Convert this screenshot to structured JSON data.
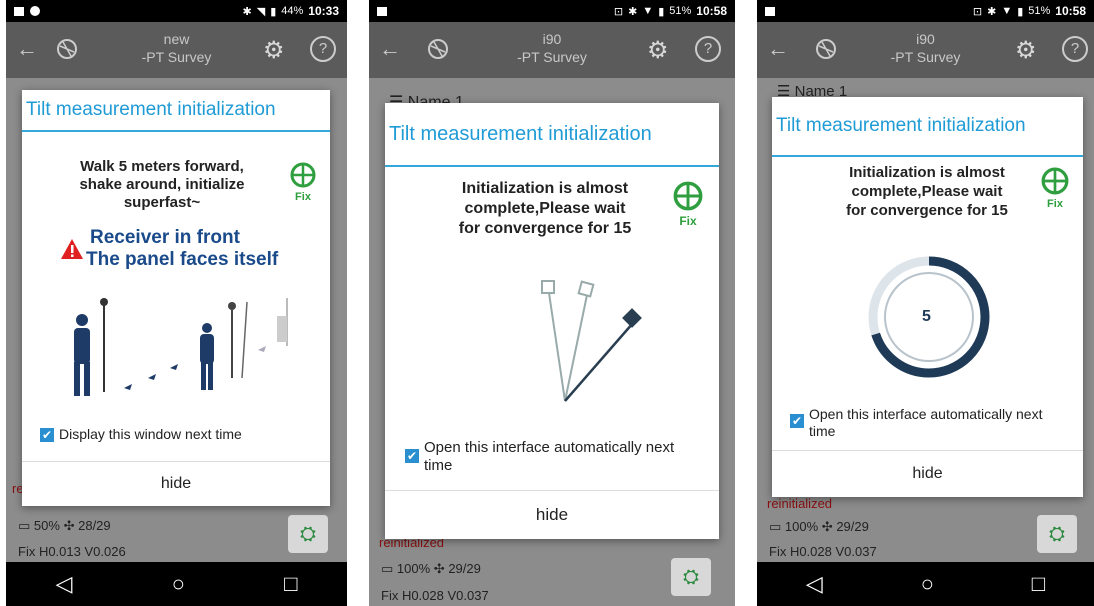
{
  "status": {
    "left": {
      "battery": "44%",
      "time": "10:33"
    },
    "middle": {
      "battery": "51%",
      "time": "10:58"
    },
    "right": {
      "battery": "51%",
      "time": "10:58"
    }
  },
  "apps": {
    "left": {
      "device": "new",
      "mode": "-PT Survey"
    },
    "middle": {
      "device": "i90",
      "mode": "-PT Survey"
    },
    "right": {
      "device": "i90",
      "mode": "-PT Survey"
    }
  },
  "background": {
    "name_label": "Name",
    "name_value": "1",
    "reinit_text": "reinitialized",
    "left": {
      "battery_pct": "50%",
      "sats": "28/29",
      "fix_line": "Fix H0.013 V0.026"
    },
    "middle": {
      "battery_pct": "100%",
      "sats": "29/29",
      "fix_line": "Fix H0.028 V0.037"
    },
    "right": {
      "battery_pct": "100%",
      "sats": "29/29",
      "fix_line": "Fix H0.028 V0.037"
    }
  },
  "dialog_left": {
    "title": "Tilt measurement initialization",
    "message_line1": "Walk 5 meters forward,",
    "message_line2": "shake around, initialize",
    "message_line3": "superfast~",
    "fix_label": "Fix",
    "warning_line1": "Receiver in front",
    "warning_line2": "The panel faces itself",
    "checkbox_label": "Display this window next time",
    "hide_label": "hide"
  },
  "dialog_middle": {
    "title": "Tilt measurement initialization",
    "message_line1": "Initialization is almost",
    "message_line2": "complete,Please wait",
    "message_line3": "for convergence for 15",
    "fix_label": "Fix",
    "checkbox_line1": "Open this interface automatically next",
    "checkbox_line2": "time",
    "hide_label": "hide"
  },
  "dialog_right": {
    "title": "Tilt measurement initialization",
    "message_line1": "Initialization is almost",
    "message_line2": "complete,Please wait",
    "message_line3": "for convergence for 15",
    "fix_label": "Fix",
    "countdown": "5",
    "countdown_progress": 0.7,
    "checkbox_line1": "Open this interface automatically next",
    "checkbox_line2": "time",
    "hide_label": "hide"
  },
  "colors": {
    "accent": "#1f9bd6",
    "fix_green": "#2e9e3e",
    "warning_blue": "#1a4a8a",
    "ring": "#1f3a56"
  }
}
